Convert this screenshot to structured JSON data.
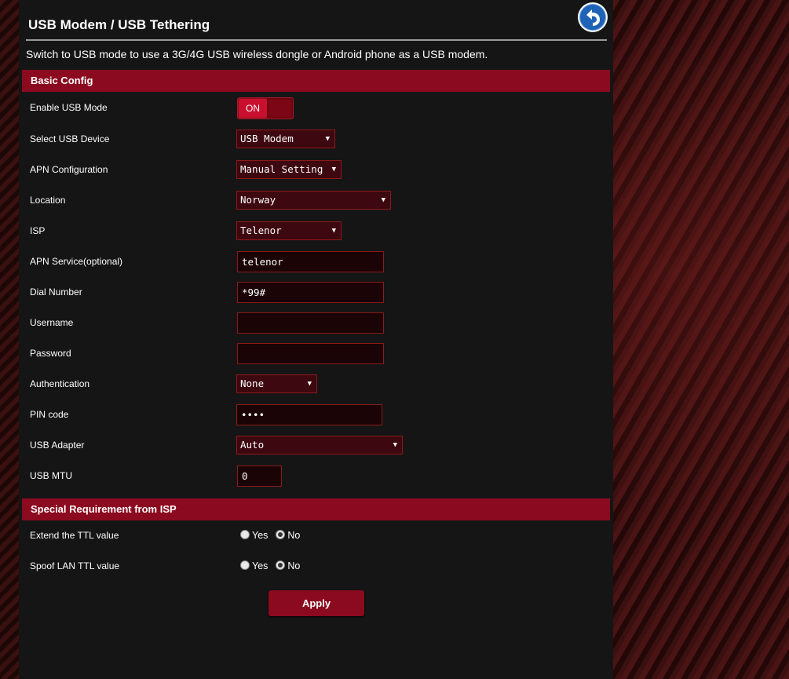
{
  "page": {
    "title": "USB Modem / USB Tethering",
    "description": "Switch to USB mode to use a 3G/4G USB wireless dongle or Android phone as a USB modem."
  },
  "basic_config": {
    "header": "Basic Config",
    "enable_usb_mode": {
      "label": "Enable USB Mode",
      "state": "ON"
    },
    "select_usb_device": {
      "label": "Select USB Device",
      "value": "USB Modem"
    },
    "apn_configuration": {
      "label": "APN Configuration",
      "value": "Manual Setting"
    },
    "location": {
      "label": "Location",
      "value": "Norway"
    },
    "isp": {
      "label": "ISP",
      "value": "Telenor"
    },
    "apn_service": {
      "label": "APN Service(optional)",
      "value": "telenor"
    },
    "dial_number": {
      "label": "Dial Number",
      "value": "*99#"
    },
    "username": {
      "label": "Username",
      "value": ""
    },
    "password": {
      "label": "Password",
      "value": ""
    },
    "authentication": {
      "label": "Authentication",
      "value": "None"
    },
    "pin_code": {
      "label": "PIN code",
      "value": "••••"
    },
    "usb_adapter": {
      "label": "USB Adapter",
      "value": "Auto"
    },
    "usb_mtu": {
      "label": "USB MTU",
      "value": "0"
    }
  },
  "special_requirement": {
    "header": "Special Requirement from ISP",
    "extend_ttl": {
      "label": "Extend the TTL value",
      "yes": "Yes",
      "no": "No",
      "selected": "No"
    },
    "spoof_lan_ttl": {
      "label": "Spoof LAN TTL value",
      "yes": "Yes",
      "no": "No",
      "selected": "No"
    }
  },
  "actions": {
    "apply_label": "Apply"
  },
  "icons": {
    "back": "back-arrow-icon",
    "dropdown": "triangle-down-icon"
  },
  "colors": {
    "accent": "#8c0a1f",
    "panel": "#151515",
    "input_border": "#8c1a1a"
  }
}
